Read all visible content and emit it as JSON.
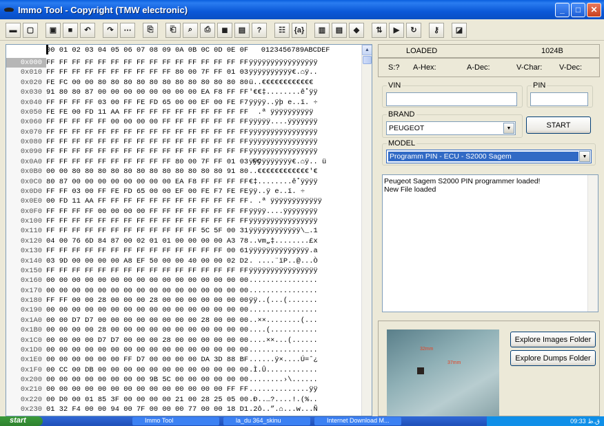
{
  "window": {
    "title": "Immo Tool - Copyright (TMW electronic)"
  },
  "toolbar": {
    "buttons": [
      "save-bin",
      "new",
      "open",
      "save",
      "undo",
      "redo",
      "select",
      "copy-block",
      "paste-block",
      "find",
      "print",
      "tool1",
      "tool2",
      "help",
      "about",
      "text-mode",
      "calc",
      "tool3",
      "goto",
      "swap",
      "export",
      "refresh",
      "key",
      "chip"
    ],
    "glyphs": [
      "▬",
      "▢",
      "▣",
      "■",
      "↶",
      "↷",
      "⋯",
      "⎘",
      "⎗",
      "⌕",
      "⎙",
      "◼",
      "▤",
      "?",
      "☷",
      "{a}",
      "▥",
      "▤",
      "◆",
      "⇅",
      "▶",
      "↻",
      "⚷",
      "◪"
    ]
  },
  "hex": {
    "header": "00 01 02 03 04 05 06 07 08 09 0A 0B 0C 0D 0E 0F   0123456789ABCDEF",
    "rows": [
      {
        "off": "0x000",
        "hex": "FF FF FF FF FF FF FF FF FF FF FF FF FF FF FF FF",
        "asc": "ÿÿÿÿÿÿÿÿÿÿÿÿÿÿÿÿ"
      },
      {
        "off": "0x010",
        "hex": "FF FF FF FF FF FF FF FF FF FF 80 00 7F FF 01 03",
        "asc": "ÿÿÿÿÿÿÿÿÿÿ€.⌂ÿ.."
      },
      {
        "off": "0x020",
        "hex": "FE FC 00 00 80 80 80 80 80 80 80 80 80 80 80 80",
        "asc": "ü..€€€€€€€€€€€€"
      },
      {
        "off": "0x030",
        "hex": "91 80 80 87 00 00 00 00 00 00 00 00 EA F8 FF FF",
        "asc": "'€€‡........ê˚ÿÿ"
      },
      {
        "off": "0x040",
        "hex": "FF FF FF FF 03 00 FF FE FD 65 00 00 EF 00 FE F7",
        "asc": "ÿÿÿÿ..ÿþ e..ï. ÷"
      },
      {
        "off": "0x050",
        "hex": "FE FE 00 FD 11 AA FF FF FF FF FF FF FF FF FF FF",
        "asc": "  .ª ÿÿÿÿÿÿÿÿÿÿ"
      },
      {
        "off": "0x060",
        "hex": "FF FF FF FF FF 00 00 00 00 FF FF FF FF FF FF FF",
        "asc": "ÿÿÿÿÿ....ÿÿÿÿÿÿÿ"
      },
      {
        "off": "0x070",
        "hex": "FF FF FF FF FF FF FF FF FF FF FF FF FF FF FF FF",
        "asc": "ÿÿÿÿÿÿÿÿÿÿÿÿÿÿÿÿ"
      },
      {
        "off": "0x080",
        "hex": "FF FF FF FF FF FF FF FF FF FF FF FF FF FF FF FF",
        "asc": "ÿÿÿÿÿÿÿÿÿÿÿÿÿÿÿÿ"
      },
      {
        "off": "0x090",
        "hex": "FF FF FF FF FF FF FF FF FF FF FF FF FF FF FF FF",
        "asc": "ÿÿÿÿÿÿÿÿÿÿÿÿÿÿÿÿ"
      },
      {
        "off": "0x0A0",
        "hex": "FF FF FF FF FF FF FF FF FF FF 80 00 7F FF 01 03 FC",
        "asc": "ÿÿÿÿÿÿÿÿÿÿ€.⌂ÿ.. ü"
      },
      {
        "off": "0x0B0",
        "hex": "00 00 80 80 80 80 80 80 80 80 80 80 80 80 91 80",
        "asc": "..€€€€€€€€€€€€'€"
      },
      {
        "off": "0x0C0",
        "hex": "80 87 00 00 00 00 00 00 00 00 EA F8 FF FF FF FF",
        "asc": "€‡........ê˚ÿÿÿÿ"
      },
      {
        "off": "0x0D0",
        "hex": "FF FF 03 00 FF FE FD 65 00 00 EF 00 FE F7 FE FE",
        "asc": "ÿÿ..ÿ e..ï. ÷"
      },
      {
        "off": "0x0E0",
        "hex": "00 FD 11 AA FF FF FF FF FF FF FF FF FF FF FF FF",
        "asc": ". .ª ÿÿÿÿÿÿÿÿÿÿÿÿ"
      },
      {
        "off": "0x0F0",
        "hex": "FF FF FF FF 00 00 00 00 FF FF FF FF FF FF FF FF",
        "asc": "ÿÿÿÿ....ÿÿÿÿÿÿÿÿ"
      },
      {
        "off": "0x100",
        "hex": "FF FF FF FF FF FF FF FF FF FF FF FF FF FF FF FF",
        "asc": "ÿÿÿÿÿÿÿÿÿÿÿÿÿÿÿÿ"
      },
      {
        "off": "0x110",
        "hex": "FF FF FF FF FF FF FF FF FF FF FF FF 5C 5F 00 31",
        "asc": "ÿÿÿÿÿÿÿÿÿÿÿÿ\\_.1"
      },
      {
        "off": "0x120",
        "hex": "04 00 76 6D 84 87 00 02 01 01 00 00 00 00 A3 78",
        "asc": "..vm„‡........£x"
      },
      {
        "off": "0x130",
        "hex": "FF FF FF FF FF FF FF FF FF FF FF FF FF FF 00 61",
        "asc": "ÿÿÿÿÿÿÿÿÿÿÿÿÿÿ.a"
      },
      {
        "off": "0x140",
        "hex": "03 9D 00 00 00 00 A8 EF 50 00 00 40 00 00 02 D2",
        "asc": ". ....¨ïP..@...Ò"
      },
      {
        "off": "0x150",
        "hex": "FF FF FF FF FF FF FF FF FF FF FF FF FF FF FF FF",
        "asc": "ÿÿÿÿÿÿÿÿÿÿÿÿÿÿÿÿ"
      },
      {
        "off": "0x160",
        "hex": "00 00 00 00 00 00 00 00 00 00 00 00 00 00 00 00",
        "asc": "................"
      },
      {
        "off": "0x170",
        "hex": "00 00 00 00 00 00 00 00 00 00 00 00 00 00 00 00",
        "asc": "................"
      },
      {
        "off": "0x180",
        "hex": "FF FF 00 00 28 00 00 00 28 00 00 00 00 00 00 00",
        "asc": "ÿÿ..(...(......."
      },
      {
        "off": "0x190",
        "hex": "00 00 00 00 00 00 00 00 00 00 00 00 00 00 00 00",
        "asc": "................"
      },
      {
        "off": "0x1A0",
        "hex": "00 00 D7 D7 00 00 00 00 00 00 00 00 28 00 00 00",
        "asc": "..××........(..."
      },
      {
        "off": "0x1B0",
        "hex": "00 00 00 00 28 00 00 00 00 00 00 00 00 00 00 00",
        "asc": "....(..........."
      },
      {
        "off": "0x1C0",
        "hex": "00 00 00 00 D7 D7 00 00 00 28 00 00 00 00 00 00",
        "asc": "....××...(......"
      },
      {
        "off": "0x1D0",
        "hex": "00 00 00 00 00 00 00 00 00 00 00 00 00 00 00 00",
        "asc": "................"
      },
      {
        "off": "0x1E0",
        "hex": "00 00 00 00 00 00 FF D7 00 00 00 00 DA 3D 88 BF",
        "asc": "......ÿ×....Ú=ˆ¿"
      },
      {
        "off": "0x1F0",
        "hex": "00 CC 00 DB 00 00 00 00 00 00 00 00 00 00 00 00",
        "asc": ".Ì.Û............"
      },
      {
        "off": "0x200",
        "hex": "00 00 00 00 00 00 00 00 9B 5C 00 00 00 00 00 00",
        "asc": "........›\\......"
      },
      {
        "off": "0x210",
        "hex": "00 00 00 00 00 00 00 00 00 00 00 00 00 00 FF FF",
        "asc": "..............ÿÿ"
      },
      {
        "off": "0x220",
        "hex": "00 D0 00 01 85 3F 00 00 00 00 21 00 28 25 05 00",
        "asc": ".Ð..…?....!.(%.."
      },
      {
        "off": "0x230",
        "hex": "01 32 F4 00 00 94 00 7F 00 00 00 77 00 00 18 D1",
        "asc": ".2ô..”.⌂...w...Ñ"
      }
    ]
  },
  "status": {
    "loaded": "LOADED",
    "size": "1024B",
    "s": "S:?",
    "ahex": "A-Hex:",
    "adec": "A-Dec:",
    "vchar": "V-Char:",
    "vdec": "V-Dec:"
  },
  "form": {
    "vin_label": "VIN",
    "pin_label": "PIN",
    "vin_value": "",
    "pin_value": "",
    "brand_label": "BRAND",
    "brand_value": "PEUGEOT",
    "start_label": "START",
    "model_label": "MODEL",
    "model_value": "Programm PIN  - ECU - S2000 Sagem"
  },
  "log": {
    "line1": "Peugeot Sagem S2000 PIN programmer loaded!",
    "line2": "New File loaded"
  },
  "images": {
    "explore_images": "Explore Images Folder",
    "explore_dumps": "Explore Dumps Folder",
    "photo_label1": "32mm",
    "photo_label2": "37mm"
  },
  "taskbar": {
    "start": "start",
    "tasks": [
      "Immo Tool",
      "la_du 364_skinu",
      "Internet Download M..."
    ],
    "clock": "09:33 ق.ظ"
  },
  "colors": {
    "title_blue": "#0a5fde",
    "select_blue": "#316ac5",
    "hex_blue": "#0000d0"
  }
}
